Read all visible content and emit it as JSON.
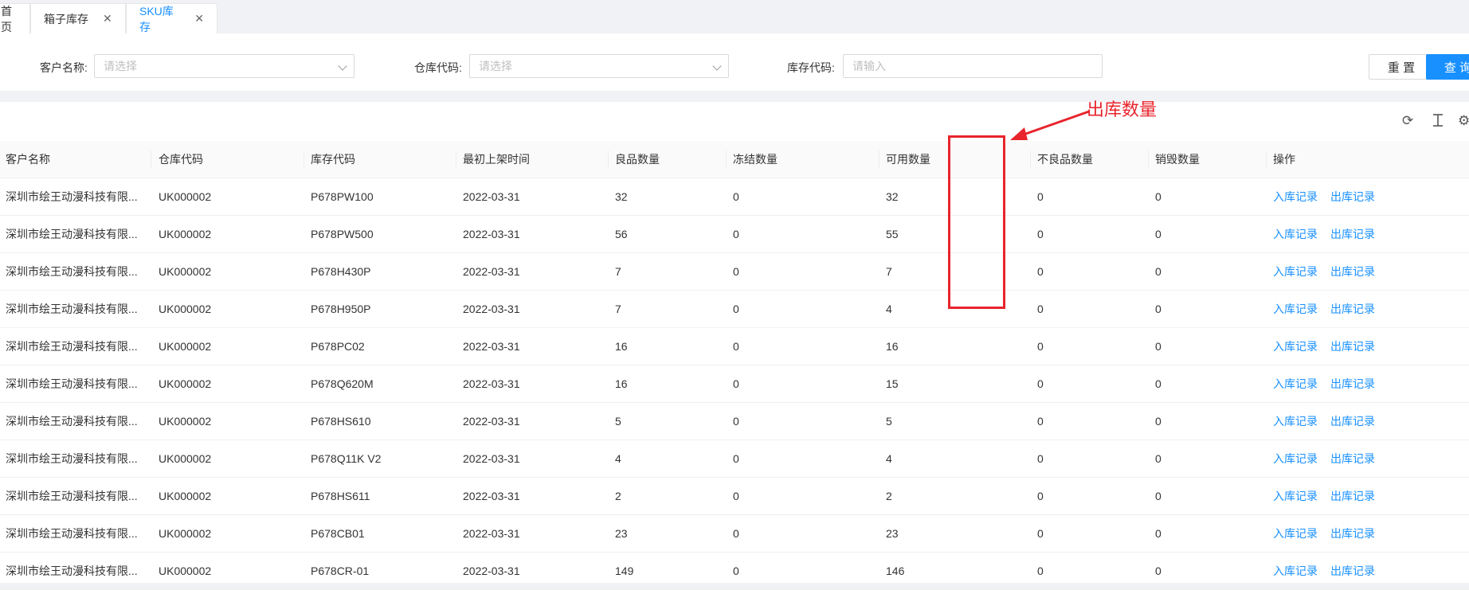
{
  "tabs": [
    {
      "label": "首页",
      "active": false,
      "closable": false
    },
    {
      "label": "箱子库存",
      "active": false,
      "closable": true
    },
    {
      "label": "SKU库存",
      "active": true,
      "closable": true
    }
  ],
  "filters": {
    "customer_label": "客户名称:",
    "customer_placeholder": "请选择",
    "warehouse_label": "仓库代码:",
    "warehouse_placeholder": "请选择",
    "stock_label": "库存代码:",
    "stock_placeholder": "请输入",
    "reset_label": "重 置",
    "query_label": "查 询"
  },
  "colors": {
    "primary": "#1890ff",
    "annotation": "#e8242c"
  },
  "table": {
    "columns": [
      "客户名称",
      "仓库代码",
      "库存代码",
      "最初上架时间",
      "良品数量",
      "冻结数量",
      "可用数量",
      "",
      "不良品数量",
      "销毁数量",
      "操作"
    ],
    "action_in": "入库记录",
    "action_out": "出库记录",
    "rows": [
      [
        "深圳市绘王动漫科技有限...",
        "UK000002",
        "P678PW100",
        "2022-03-31",
        "32",
        "0",
        "32",
        "",
        "0",
        "0"
      ],
      [
        "深圳市绘王动漫科技有限...",
        "UK000002",
        "P678PW500",
        "2022-03-31",
        "56",
        "0",
        "55",
        "",
        "0",
        "0"
      ],
      [
        "深圳市绘王动漫科技有限...",
        "UK000002",
        "P678H430P",
        "2022-03-31",
        "7",
        "0",
        "7",
        "",
        "0",
        "0"
      ],
      [
        "深圳市绘王动漫科技有限...",
        "UK000002",
        "P678H950P",
        "2022-03-31",
        "7",
        "0",
        "4",
        "",
        "0",
        "0"
      ],
      [
        "深圳市绘王动漫科技有限...",
        "UK000002",
        "P678PC02",
        "2022-03-31",
        "16",
        "0",
        "16",
        "",
        "0",
        "0"
      ],
      [
        "深圳市绘王动漫科技有限...",
        "UK000002",
        "P678Q620M",
        "2022-03-31",
        "16",
        "0",
        "15",
        "",
        "0",
        "0"
      ],
      [
        "深圳市绘王动漫科技有限...",
        "UK000002",
        "P678HS610",
        "2022-03-31",
        "5",
        "0",
        "5",
        "",
        "0",
        "0"
      ],
      [
        "深圳市绘王动漫科技有限...",
        "UK000002",
        "P678Q11K V2",
        "2022-03-31",
        "4",
        "0",
        "4",
        "",
        "0",
        "0"
      ],
      [
        "深圳市绘王动漫科技有限...",
        "UK000002",
        "P678HS611",
        "2022-03-31",
        "2",
        "0",
        "2",
        "",
        "0",
        "0"
      ],
      [
        "深圳市绘王动漫科技有限...",
        "UK000002",
        "P678CB01",
        "2022-03-31",
        "23",
        "0",
        "23",
        "",
        "0",
        "0"
      ],
      [
        "深圳市绘王动漫科技有限...",
        "UK000002",
        "P678CR-01",
        "2022-03-31",
        "149",
        "0",
        "146",
        "",
        "0",
        "0"
      ]
    ]
  },
  "toolbar_icons": [
    "refresh-icon",
    "column-height-icon",
    "settings-icon"
  ],
  "annotation": {
    "text": "出库数量"
  }
}
